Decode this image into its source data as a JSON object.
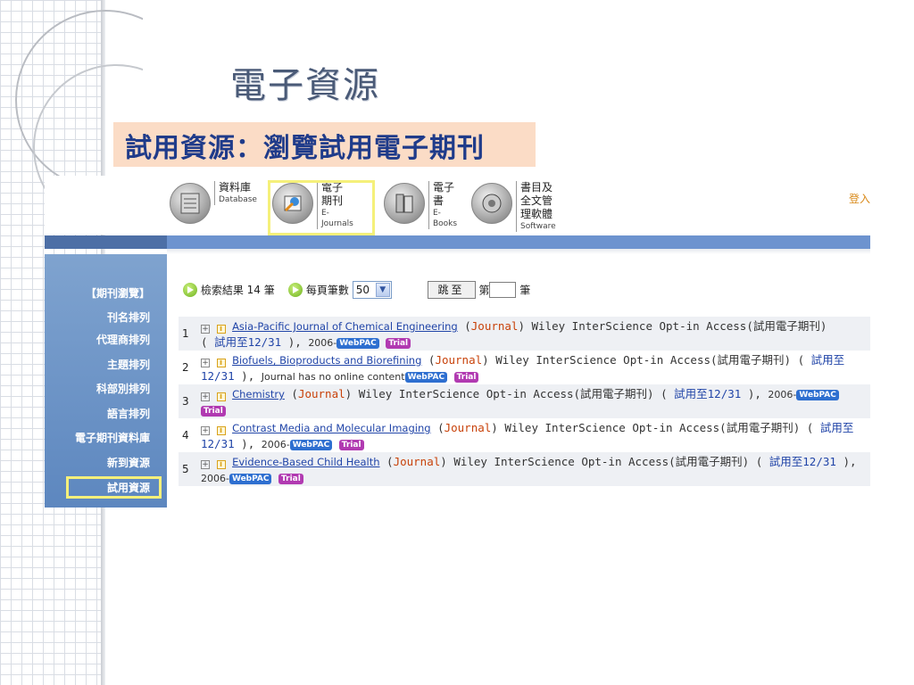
{
  "slide": {
    "title": "電子資源",
    "subtitle": "試用資源：瀏覽試用電子期刊"
  },
  "toolbar": {
    "items": [
      {
        "zh": "資料庫",
        "en": "Database",
        "icon": "database-icon"
      },
      {
        "zh": "電子期刊",
        "en": "E-Journals",
        "icon": "ejournal-icon"
      },
      {
        "zh": "電子書",
        "en": "E-Books",
        "icon": "ebook-icon"
      },
      {
        "zh": "書目及全文管理軟體",
        "en": "Software",
        "icon": "software-icon"
      }
    ],
    "login": "登入"
  },
  "sidebar": {
    "header": "【期刊瀏覽】",
    "items": [
      "刊名排列",
      "代理商排列",
      "主題排列",
      "科部別排列",
      "語言排列",
      "電子期刊資料庫",
      "新到資源",
      "試用資源"
    ],
    "active": "試用資源"
  },
  "search": {
    "result_label": "檢索結果",
    "result_count": "14",
    "result_unit": "筆",
    "per_page_label": "每頁筆數",
    "per_page_value": "50",
    "jump_button": "跳至",
    "page_prefix": "第",
    "page_suffix": "筆"
  },
  "results": [
    {
      "num": "1",
      "title": "Asia-Pacific Journal of Chemical Engineering",
      "type": "Journal",
      "provider": "Wiley InterScience Opt-in Access(試用電子期刊)",
      "trial": "試用至12/31",
      "coverage": "2006-",
      "line_break_after": "provider"
    },
    {
      "num": "2",
      "title": "Biofuels, Bioproducts and Biorefining",
      "type": "Journal",
      "provider": "Wiley InterScience Opt-in Access(試用電子期刊)",
      "trial_a": "試用至",
      "trial_b": "12/31",
      "coverage": "Journal has no online content"
    },
    {
      "num": "3",
      "title": "Chemistry",
      "type": "Journal",
      "provider": "Wiley InterScience Opt-in Access(試用電子期刊)",
      "trial": "試用至12/31",
      "coverage": "2006-"
    },
    {
      "num": "4",
      "title": "Contrast Media and Molecular Imaging",
      "type": "Journal",
      "provider": "Wiley InterScience Opt-in Access(試用電子期刊)",
      "trial_a": "試用至",
      "trial_b": "12/31",
      "coverage": "2006-"
    },
    {
      "num": "5",
      "title": "Evidence-Based Child Health",
      "type": "Journal",
      "provider": "Wiley InterScience Opt-in Access(試用電子期刊)",
      "trial": "試用至12/31",
      "coverage": "2006-"
    }
  ],
  "badges": {
    "webpac": "WebPAC",
    "trial": "Trial"
  },
  "colors": {
    "accent_blue": "#6d93cf",
    "sidebar_blue": "#5d87bf",
    "highlight_yellow": "#f5f07a",
    "subtitle_bg": "#fbdcc6",
    "journal_orange": "#c8420a",
    "link_blue": "#2145a8"
  }
}
